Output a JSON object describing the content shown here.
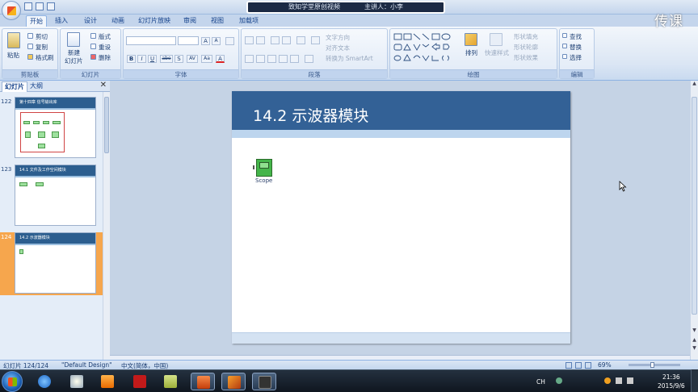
{
  "window": {
    "caption_left": "致知学堂原创视频",
    "caption_right": "主讲人：小李",
    "watermark": "传课"
  },
  "tabs": [
    {
      "label": "开始",
      "active": true
    },
    {
      "label": "插入"
    },
    {
      "label": "设计"
    },
    {
      "label": "动画"
    },
    {
      "label": "幻灯片放映"
    },
    {
      "label": "审阅"
    },
    {
      "label": "视图"
    },
    {
      "label": "加载项"
    }
  ],
  "ribbon": {
    "clipboard": {
      "paste": "粘贴",
      "cut": "剪切",
      "copy": "复制",
      "format_painter": "格式刷",
      "label": "剪贴板"
    },
    "slides": {
      "new_slide_line1": "新建",
      "new_slide_line2": "幻灯片",
      "layout": "版式",
      "reset": "重设",
      "delete": "删除",
      "label": "幻灯片"
    },
    "font": {
      "label": "字体",
      "grow": "A",
      "shrink": "A",
      "bold": "B",
      "italic": "I",
      "underline": "U",
      "strike": "abe",
      "shadow": "S",
      "spacing": "AV",
      "case": "Aa",
      "color": "A"
    },
    "paragraph": {
      "label": "段落",
      "text_direction": "文字方向",
      "align_text": "对齐文本",
      "smartart": "转换为 SmartArt"
    },
    "drawing": {
      "label": "绘图",
      "arrange": "排列",
      "quick_styles": "快速样式",
      "shape_fill": "形状填充",
      "shape_outline": "形状轮廓",
      "shape_effects": "形状效果"
    },
    "editing": {
      "label": "编辑",
      "find": "查找",
      "replace": "替换",
      "select": "选择"
    }
  },
  "left_panel": {
    "tab_slides": "幻灯片",
    "tab_outline": "大纲",
    "close": "✕",
    "slides": [
      {
        "number": "122",
        "title": "第十四章 信号输出库"
      },
      {
        "number": "123",
        "title": "14.1 文件及工作空间模块"
      },
      {
        "number": "124",
        "title": "14.2 示波器模块",
        "selected": true
      }
    ]
  },
  "slide": {
    "title": "14.2 示波器模块",
    "block_label": "Scope"
  },
  "status": {
    "slide_count": "幻灯片 124/124",
    "theme": "\"Default Design\"",
    "language": "中文(简体，中国)",
    "zoom": "69%"
  },
  "taskbar": {
    "lang": "CH",
    "time": "21:36",
    "date": "2015/9/6"
  }
}
